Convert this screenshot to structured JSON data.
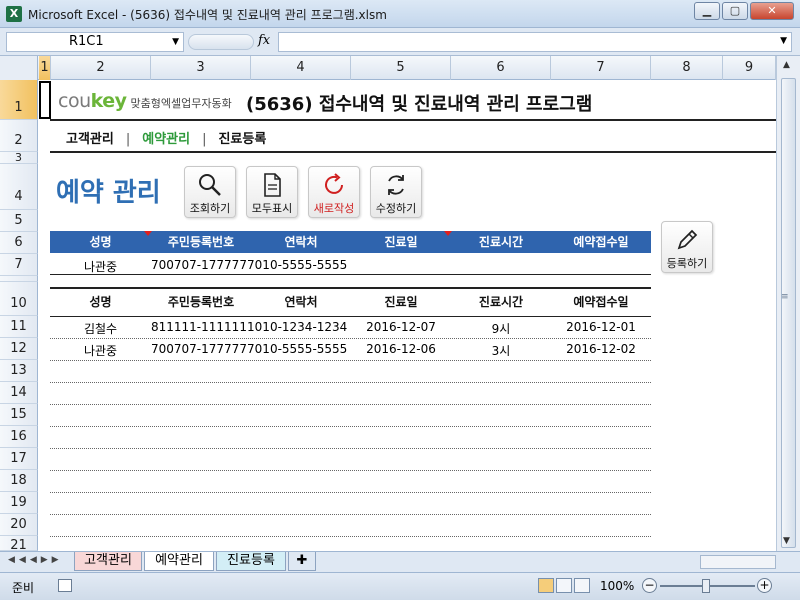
{
  "window": {
    "title": "Microsoft Excel - (5636) 접수내역 및 진료내역 관리 프로그램.xlsm",
    "app_icon": "X",
    "minimize": "▁",
    "restore": "▢",
    "close": "✕"
  },
  "formula_bar": {
    "name_box": "R1C1",
    "fx": "fx",
    "formula": ""
  },
  "columns": [
    "1",
    "2",
    "3",
    "4",
    "5",
    "6",
    "7",
    "8",
    "9"
  ],
  "rows": [
    "1",
    "2",
    "3",
    "4",
    "5",
    "6",
    "7",
    "10",
    "11",
    "12",
    "13",
    "14",
    "15",
    "16",
    "17",
    "18",
    "19",
    "20",
    "21"
  ],
  "header": {
    "logo_cou": "cou",
    "logo_key": "key",
    "logo_tagline": "맞춤형엑셀업무자동화",
    "page_title": "(5636) 접수내역 및 진료내역 관리 프로그램"
  },
  "nav": {
    "customers": "고객관리",
    "reservations": "예약관리",
    "treatment": "진료등록",
    "separator": "|"
  },
  "section_title": "예약 관리",
  "toolbar": {
    "search": "조회하기",
    "show_all": "모두표시",
    "new": "새로작성",
    "edit": "수정하기",
    "register": "등록하기"
  },
  "input_table": {
    "headers": [
      "성명",
      "주민등록번호",
      "연락처",
      "진료일",
      "진료시간",
      "예약접수일"
    ],
    "row": [
      "나관중",
      "700707-1777777",
      "010-5555-5555",
      "",
      "",
      ""
    ]
  },
  "list_table": {
    "headers": [
      "성명",
      "주민등록번호",
      "연락처",
      "진료일",
      "진료시간",
      "예약접수일"
    ],
    "rows": [
      [
        "김철수",
        "811111-1111111",
        "010-1234-1234",
        "2016-12-07",
        "9시",
        "2016-12-01"
      ],
      [
        "나관중",
        "700707-1777777",
        "010-5555-5555",
        "2016-12-06",
        "3시",
        "2016-12-02"
      ]
    ]
  },
  "sheet_tabs": [
    "고객관리",
    "예약관리",
    "진료등록"
  ],
  "status": {
    "ready": "준비",
    "zoom": "100%",
    "zoom_minus": "−",
    "zoom_plus": "+"
  },
  "colors": {
    "header_blue": "#2f64ae",
    "section_title": "#2f6fb4",
    "nav_active": "#2d9a3a",
    "logo_green": "#6bb539"
  }
}
